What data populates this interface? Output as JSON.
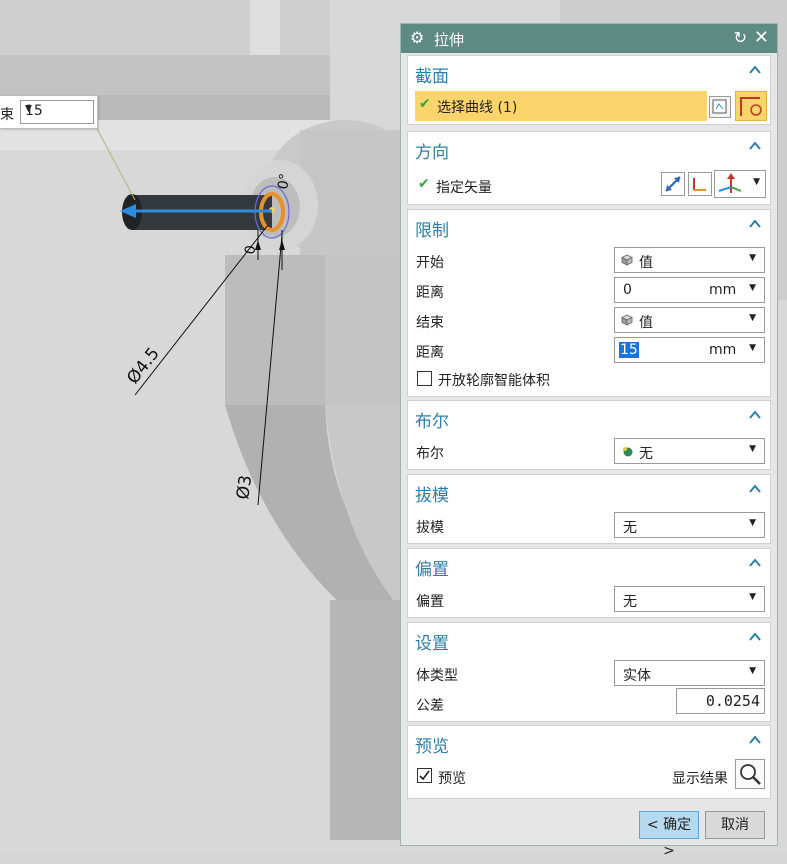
{
  "floating_label": {
    "label": "结束",
    "value": "15"
  },
  "viewport": {
    "dim_outer": "Ø4.5",
    "dim_inner": "Ø3",
    "dim_angle": "0°",
    "dim_small": "0"
  },
  "dialog": {
    "title": "拉伸",
    "section_section": {
      "title": "截面",
      "select_curve": "选择曲线 (1)"
    },
    "section_direction": {
      "title": "方向",
      "vector": "指定矢量"
    },
    "section_limits": {
      "title": "限制",
      "start_label": "开始",
      "start_value": "值",
      "dist1_label": "距离",
      "dist1_value": "0",
      "dist1_unit": "mm",
      "end_label": "结束",
      "end_value": "值",
      "dist2_label": "距离",
      "dist2_value": "15",
      "dist2_unit": "mm",
      "open_profile": "开放轮廓智能体积"
    },
    "section_boolean": {
      "title": "布尔",
      "label": "布尔",
      "value": "无"
    },
    "section_draft": {
      "title": "拔模",
      "label": "拔模",
      "value": "无"
    },
    "section_offset": {
      "title": "偏置",
      "label": "偏置",
      "value": "无"
    },
    "section_settings": {
      "title": "设置",
      "body_type_label": "体类型",
      "body_type_value": "实体",
      "tolerance_label": "公差",
      "tolerance_value": "0.0254"
    },
    "section_preview": {
      "title": "预览",
      "preview_label": "预览",
      "show_result": "显示结果"
    },
    "ok": "< 确定 >",
    "cancel": "取消"
  },
  "colors": {
    "accent": "#2e7fa8",
    "titlebar": "#5d8a83",
    "highlight": "#fcd46b",
    "ok": "#b7d9ee"
  }
}
